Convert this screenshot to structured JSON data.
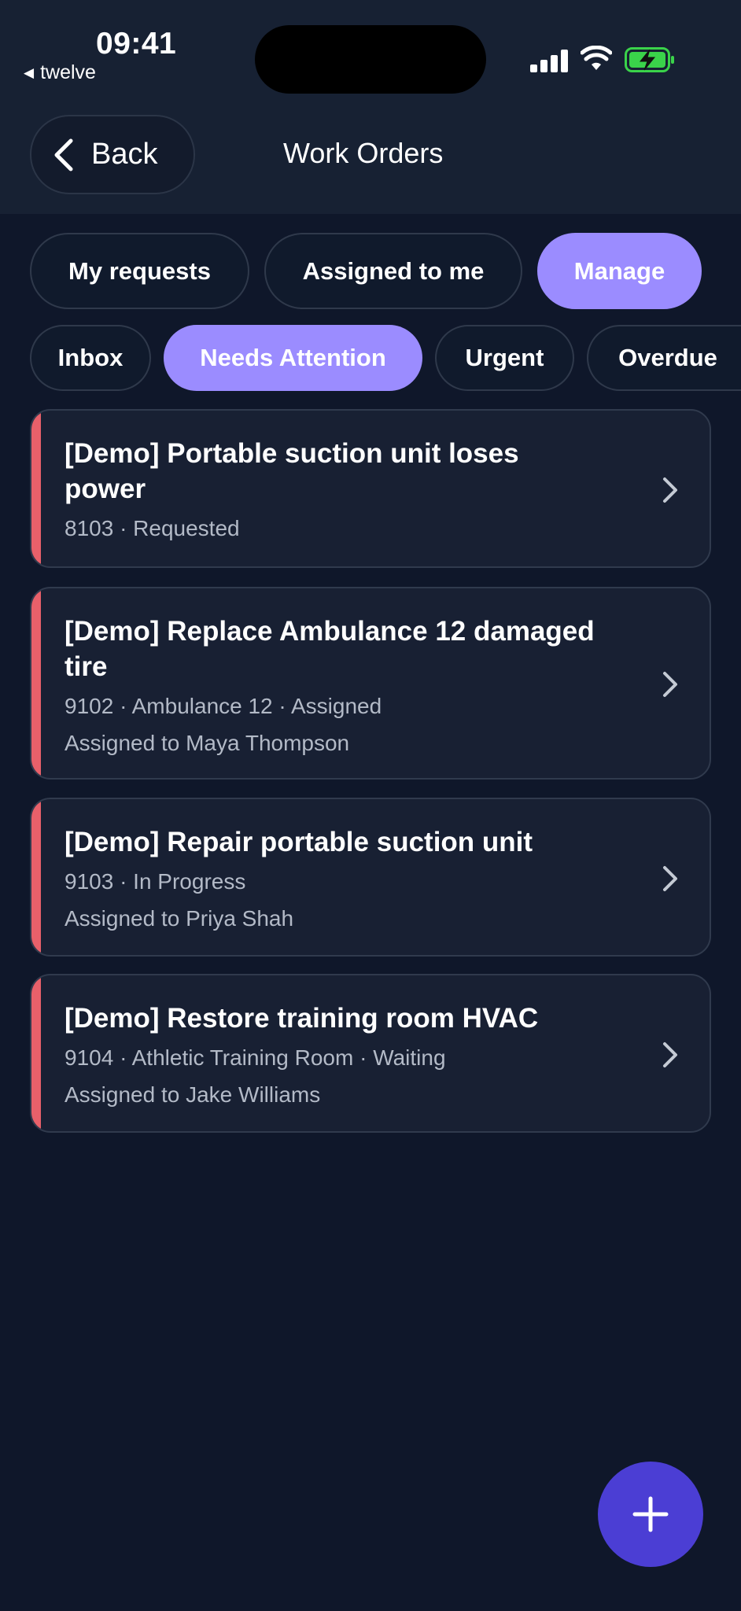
{
  "status_bar": {
    "time": "09:41",
    "carrier": "twelve",
    "carrier_back_glyph": "◀"
  },
  "nav": {
    "back_label": "Back",
    "title": "Work Orders"
  },
  "tabs": [
    {
      "label": "My requests",
      "active": false
    },
    {
      "label": "Assigned to me",
      "active": false
    },
    {
      "label": "Manage",
      "active": true
    }
  ],
  "filters": [
    {
      "label": "Inbox",
      "active": false
    },
    {
      "label": "Needs Attention",
      "active": true
    },
    {
      "label": "Urgent",
      "active": false
    },
    {
      "label": "Overdue",
      "active": false
    }
  ],
  "work_orders": [
    {
      "title_line1": "[Demo] Portable suction unit loses",
      "title_line2": "power",
      "meta": "8103 · Requested",
      "assignee": ""
    },
    {
      "title_line1": "[Demo] Replace Ambulance 12 damaged",
      "title_line2": "tire",
      "meta": "9102 · Ambulance 12 · Assigned",
      "assignee": "Assigned to Maya Thompson"
    },
    {
      "title_line1": "[Demo] Repair portable suction unit",
      "title_line2": "",
      "meta": "9103 · In Progress",
      "assignee": "Assigned to Priya Shah"
    },
    {
      "title_line1": "[Demo] Restore training room HVAC",
      "title_line2": "",
      "meta": "9104 · Athletic Training Room · Waiting",
      "assignee": "Assigned to Jake Williams"
    }
  ],
  "colors": {
    "background": "#0f172a",
    "header": "#172133",
    "card": "#182033",
    "accent": "#9b8cff",
    "fab": "#4b3ed4",
    "attention_bar": "#e8606a",
    "battery_green": "#3ad34a"
  },
  "icons": {
    "back": "chevron-left-icon",
    "row": "chevron-right-icon",
    "fab": "plus-icon",
    "signal": "signal-icon",
    "wifi": "wifi-icon",
    "battery": "battery-charging-icon"
  }
}
